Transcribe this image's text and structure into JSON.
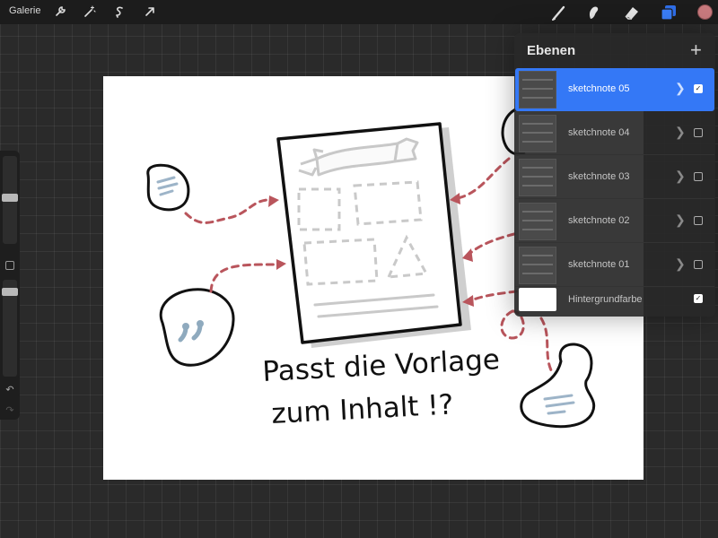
{
  "topbar": {
    "gallery_label": "Galerie",
    "left_tools": [
      "wrench-icon",
      "magic-wand-icon",
      "selection-icon",
      "transform-arrow-icon"
    ],
    "right_tools": [
      "brush-icon",
      "smudge-icon",
      "eraser-icon",
      "layers-icon"
    ],
    "active_color": "#c97a7e",
    "accent": "#3478f6"
  },
  "layers_panel": {
    "title": "Ebenen",
    "add_label": "+",
    "layers": [
      {
        "name": "sketchnote 05",
        "visible": true,
        "active": true
      },
      {
        "name": "sketchnote 04",
        "visible": false,
        "active": false
      },
      {
        "name": "sketchnote 03",
        "visible": false,
        "active": false
      },
      {
        "name": "sketchnote 02",
        "visible": false,
        "active": false
      },
      {
        "name": "sketchnote 01",
        "visible": false,
        "active": false
      }
    ],
    "background": {
      "name": "Hintergrundfarbe",
      "visible": true
    }
  },
  "canvas": {
    "headline_line1": "Passt die Vorlage",
    "headline_line2": "zum Inhalt !?"
  }
}
